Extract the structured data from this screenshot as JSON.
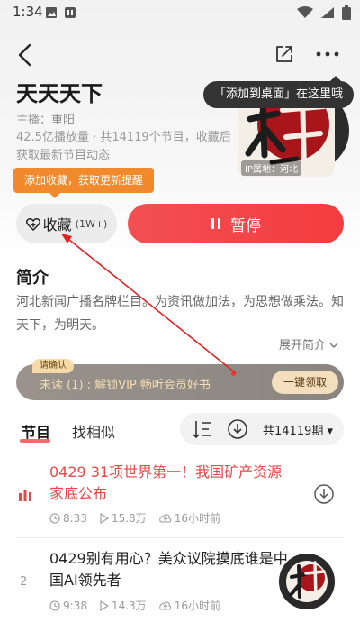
{
  "status_bar": {
    "time": "1:34"
  },
  "podcast": {
    "title": "天天天下",
    "host_label": "主播：",
    "host_name": "重阳",
    "stats_line1": "42.5亿播放量 · 共14119个节目，收藏后",
    "stats_line2": "获取最新节目动态",
    "ip_label": "IP属地：河北",
    "cover_colors": {
      "red": "#9b1c22",
      "dark": "#2b2b2b"
    }
  },
  "tooltips": {
    "add_desktop": "「添加到桌面」在这里哦",
    "favorite_hint": "添加收藏，获取更新提醒"
  },
  "actions": {
    "favorite_label": "收藏",
    "favorite_count": "(1W+)",
    "pause_label": "暂停"
  },
  "intro": {
    "heading": "简介",
    "text": "河北新闻广播名牌栏目。为资讯做加法，为思想做乘法。知天下，为明天。",
    "expand_label": "展开简介"
  },
  "vip": {
    "badge": "请确认",
    "text": "未读 (1) : 解锁VIP  畅听会员好书",
    "button": "一键领取"
  },
  "tabs": {
    "episodes": "节目",
    "similar": "找相似"
  },
  "list_tools": {
    "count_label": "共14119期 ▾"
  },
  "episodes": [
    {
      "title": "0429 31项世界第一！我国矿产资源家底公布",
      "duration": "8:33",
      "plays": "15.8万",
      "time": "16小时前",
      "playing": true
    },
    {
      "number": "2",
      "title": "0429别有用心？美众议院摸底谁是中国AI领先者",
      "duration": "9:38",
      "plays": "14.3万",
      "time": "16小时前",
      "playing": false
    }
  ],
  "theme": {
    "accent": "#f34f52",
    "orange": "#f08a2c",
    "playing_text": "#e94848"
  }
}
